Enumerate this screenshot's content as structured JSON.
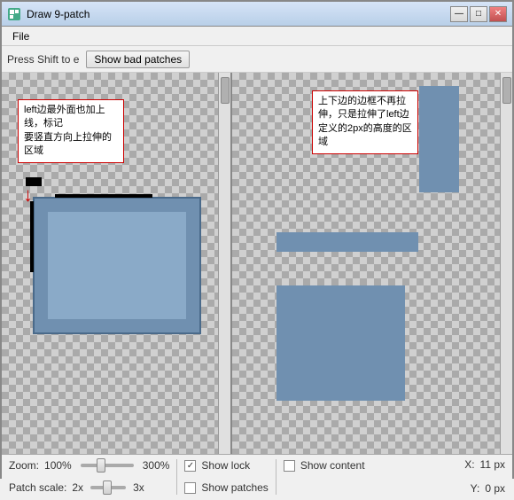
{
  "titlebar": {
    "title": "Draw 9-patch",
    "min_btn": "—",
    "max_btn": "□",
    "close_btn": "✕"
  },
  "menubar": {
    "items": [
      {
        "label": "File"
      }
    ]
  },
  "toolbar": {
    "hint_text": "Press Shift to e",
    "bad_patches_btn": "Show bad patches"
  },
  "annotations": {
    "left_text": "left边最外面也加上线，标记\n要竖直方向上拉伸的区域",
    "right_text": "上下边的边框不再拉伸，只是拉伸了left边定义的2px的高度的区域"
  },
  "statusbar": {
    "zoom_label": "Zoom:",
    "zoom_value": "100%",
    "zoom_max": "300%",
    "show_lock_label": "Show lock",
    "show_content_label": "Show content",
    "patch_scale_label": "Patch scale:",
    "patch_scale_min": "2x",
    "patch_scale_max": "3x",
    "show_patches_label": "Show patches",
    "x_label": "X:",
    "x_value": "11 px",
    "y_label": "Y:",
    "y_value": "0 px"
  }
}
